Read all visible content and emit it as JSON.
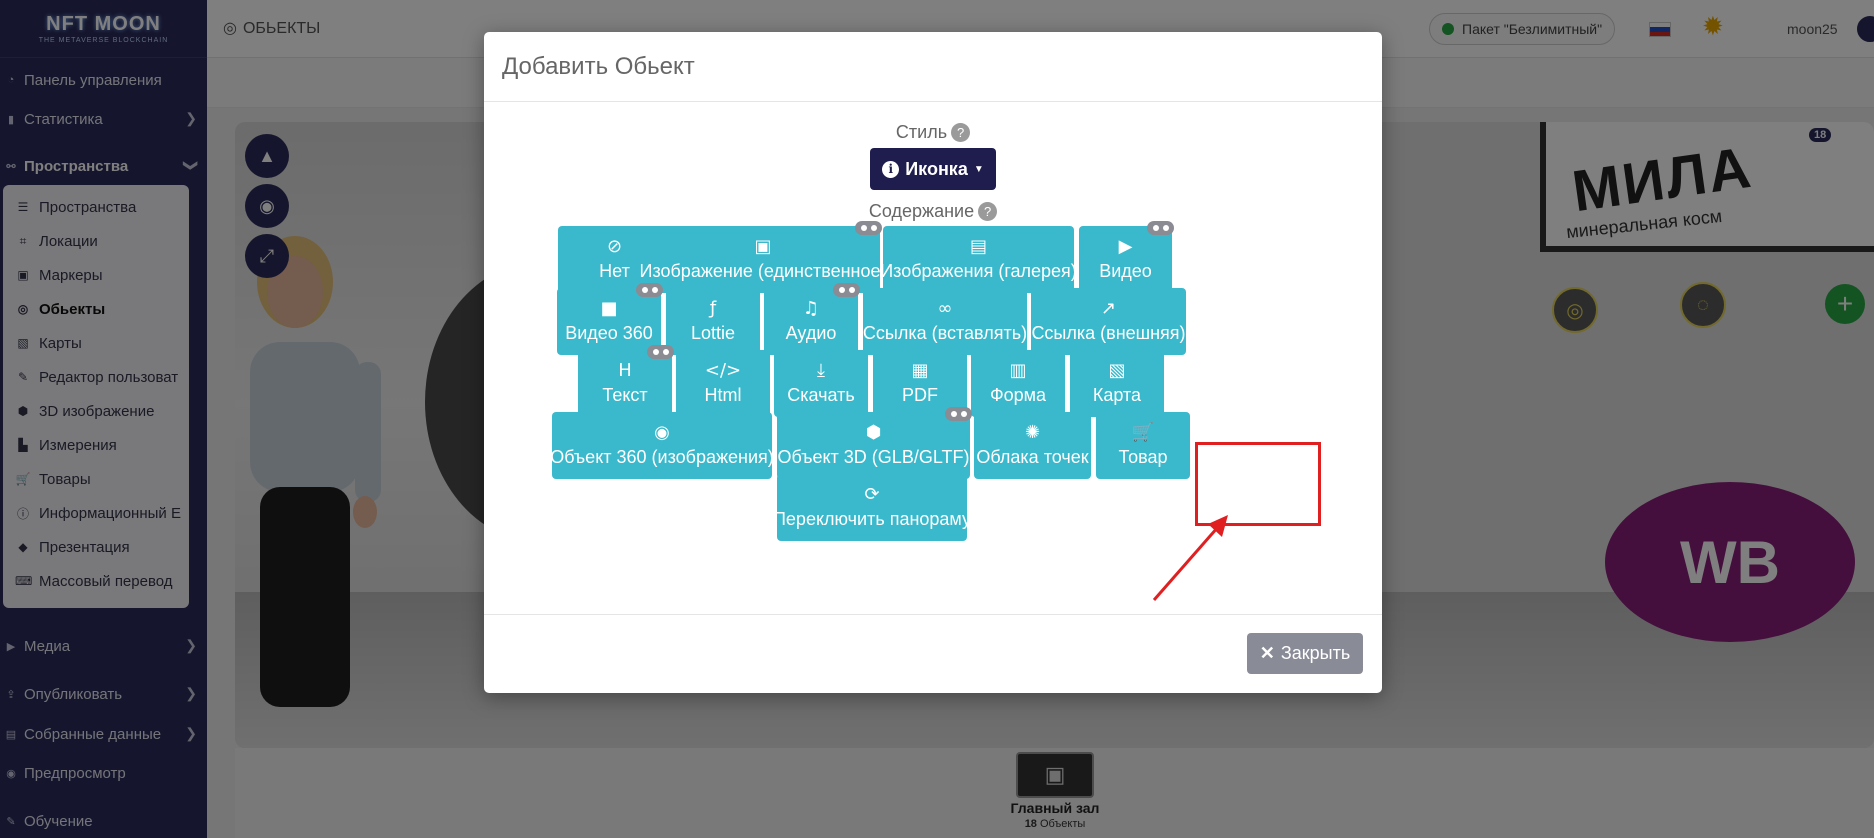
{
  "logo": {
    "line1": "NFT MOON",
    "line2": "THE METAVERSE BLOCKCHAIN"
  },
  "sidebar": {
    "items": [
      {
        "label": "Панель управления"
      },
      {
        "label": "Статистика"
      },
      {
        "label": "Пространства"
      }
    ],
    "submenu": [
      {
        "label": "Пространства",
        "icon": "list-icon"
      },
      {
        "label": "Локации",
        "icon": "vector-icon"
      },
      {
        "label": "Маркеры",
        "icon": "image-icon"
      },
      {
        "label": "Обьекты",
        "icon": "target-icon",
        "active": true
      },
      {
        "label": "Карты",
        "icon": "map-icon"
      },
      {
        "label": "Редактор пользоват",
        "icon": "edit-icon"
      },
      {
        "label": "3D изображение",
        "icon": "cube-icon"
      },
      {
        "label": "Измерения",
        "icon": "chart-icon"
      },
      {
        "label": "Товары",
        "icon": "cart-icon"
      },
      {
        "label": "Информационный Е",
        "icon": "info-icon"
      },
      {
        "label": "Презентация",
        "icon": "diamond-icon"
      },
      {
        "label": "Массовый перевод",
        "icon": "language-icon"
      }
    ],
    "bottom_items": [
      {
        "label": "Медиа"
      },
      {
        "label": "Опубликовать"
      },
      {
        "label": "Собранные данные"
      },
      {
        "label": "Предпросмотр"
      },
      {
        "label": "Обучение"
      }
    ]
  },
  "topbar": {
    "breadcrumb": "ОБЬЕКТЫ",
    "package": "Пакет \"Безлимитный\"",
    "username": "moon25"
  },
  "scene": {
    "sign_title": "МИЛА",
    "sign_subtitle": "минеральная косм",
    "wb_text": "WB",
    "badge": "18"
  },
  "bottom": {
    "space_name": "Главный зал",
    "count": "18",
    "count_label": "Объекты"
  },
  "modal": {
    "title": "Добавить Обьект",
    "style_label": "Стиль",
    "style_value": "Иконка",
    "content_label": "Содержание",
    "help": "?",
    "close_label": "Закрыть",
    "buttons": [
      {
        "label": "Нет",
        "icon": "ban-icon",
        "glyph": "⊘",
        "vr": false
      },
      {
        "label": "Изображение (единственное)",
        "icon": "image-icon",
        "glyph": "▣",
        "vr": true
      },
      {
        "label": "Изображения (галерея)",
        "icon": "images-icon",
        "glyph": "▤",
        "vr": false
      },
      {
        "label": "Видео",
        "icon": "youtube-icon",
        "glyph": "▶",
        "vr": true
      },
      {
        "label": "Видео 360",
        "icon": "video-camera-icon",
        "glyph": "■",
        "vr": true
      },
      {
        "label": "Lottie",
        "icon": "lottie-icon",
        "glyph": "ƒ",
        "vr": false
      },
      {
        "label": "Аудио",
        "icon": "music-icon",
        "glyph": "♫",
        "vr": true
      },
      {
        "label": "Ссылка (вставлять)",
        "icon": "link-icon",
        "glyph": "∞",
        "vr": false
      },
      {
        "label": "Ссылка (внешняя)",
        "icon": "external-link-icon",
        "glyph": "↗",
        "vr": false
      },
      {
        "label": "Текст",
        "icon": "heading-icon",
        "glyph": "H",
        "vr": true
      },
      {
        "label": "Html",
        "icon": "code-icon",
        "glyph": "</>",
        "vr": false
      },
      {
        "label": "Скачать",
        "icon": "download-icon",
        "glyph": "⤓",
        "vr": false
      },
      {
        "label": "PDF",
        "icon": "pdf-icon",
        "glyph": "▦",
        "vr": false
      },
      {
        "label": "Форма",
        "icon": "form-icon",
        "glyph": "▥",
        "vr": false
      },
      {
        "label": "Карта",
        "icon": "map-icon",
        "glyph": "▧",
        "vr": false
      },
      {
        "label": "Объект 360 (изображения)",
        "icon": "disc-icon",
        "glyph": "◉",
        "vr": false
      },
      {
        "label": "Объект 3D (GLB/GLTF)",
        "icon": "cube-icon",
        "glyph": "⬢",
        "vr": true
      },
      {
        "label": "Облака точек",
        "icon": "dharmachakra-icon",
        "glyph": "✺",
        "vr": false
      },
      {
        "label": "Товар",
        "icon": "cart-icon",
        "glyph": "🛒",
        "vr": false
      },
      {
        "label": "Переключить панораму",
        "icon": "sync-icon",
        "glyph": "⟳",
        "vr": false
      }
    ]
  },
  "colors": {
    "sidebar": "#2a2b5a",
    "button": "#3bb9cc",
    "style_button": "#1f1c4e",
    "close_button": "#898b97",
    "highlight": "#e02020"
  }
}
